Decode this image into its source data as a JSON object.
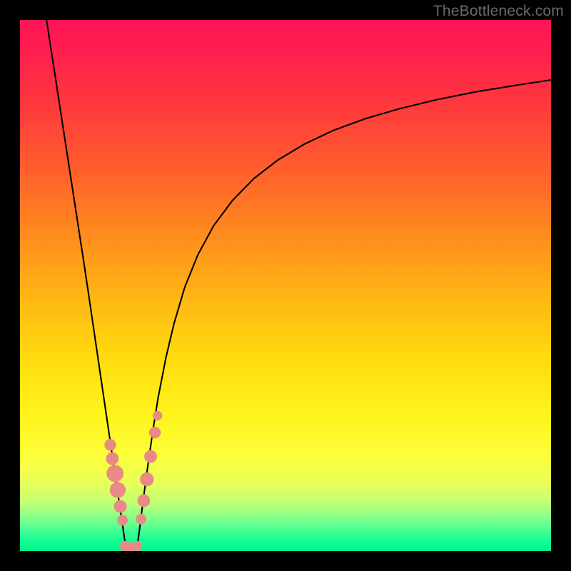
{
  "watermark": "TheBottleneck.com",
  "chart_data": {
    "type": "line",
    "title": "",
    "xlabel": "",
    "ylabel": "",
    "xlim": [
      0,
      100
    ],
    "ylim": [
      0,
      100
    ],
    "grid": false,
    "legend": false,
    "series": [
      {
        "name": "left-branch",
        "color": "#000000",
        "x": [
          5.0,
          6.0,
          7.0,
          8.0,
          9.0,
          10.0,
          11.0,
          12.0,
          13.0,
          14.0,
          15.0,
          16.0,
          17.0,
          18.0,
          18.5,
          19.0,
          19.5,
          20.0
        ],
        "y": [
          100.0,
          93.5,
          87.0,
          80.5,
          74.0,
          67.5,
          61.0,
          54.5,
          47.8,
          41.0,
          34.2,
          27.4,
          20.6,
          13.8,
          10.4,
          7.0,
          3.6,
          0.2
        ]
      },
      {
        "name": "right-branch",
        "color": "#000000",
        "x": [
          22.0,
          22.5,
          23.0,
          24.0,
          25.0,
          26.0,
          27.5,
          29.0,
          31.0,
          33.5,
          36.5,
          40.0,
          44.0,
          48.5,
          53.5,
          59.0,
          65.0,
          71.5,
          78.5,
          86.0,
          94.0,
          100.0
        ],
        "y": [
          0.2,
          4.0,
          8.0,
          15.5,
          22.5,
          28.8,
          36.5,
          42.8,
          49.6,
          55.8,
          61.3,
          66.0,
          70.1,
          73.6,
          76.6,
          79.2,
          81.4,
          83.3,
          85.0,
          86.5,
          87.8,
          88.7
        ]
      }
    ],
    "markers": [
      {
        "branch": "left",
        "x": 17.0,
        "y": 20.0,
        "r": 1.1
      },
      {
        "branch": "left",
        "x": 17.4,
        "y": 17.4,
        "r": 1.2
      },
      {
        "branch": "left",
        "x": 17.9,
        "y": 14.6,
        "r": 1.6
      },
      {
        "branch": "left",
        "x": 18.4,
        "y": 11.5,
        "r": 1.5
      },
      {
        "branch": "left",
        "x": 18.9,
        "y": 8.4,
        "r": 1.2
      },
      {
        "branch": "left",
        "x": 19.3,
        "y": 5.8,
        "r": 1.0
      },
      {
        "branch": "right",
        "x": 22.8,
        "y": 6.0,
        "r": 1.0
      },
      {
        "branch": "right",
        "x": 23.3,
        "y": 9.5,
        "r": 1.2
      },
      {
        "branch": "right",
        "x": 23.9,
        "y": 13.5,
        "r": 1.3
      },
      {
        "branch": "right",
        "x": 24.6,
        "y": 17.8,
        "r": 1.2
      },
      {
        "branch": "right",
        "x": 25.4,
        "y": 22.3,
        "r": 1.1
      },
      {
        "branch": "right",
        "x": 25.9,
        "y": 25.5,
        "r": 0.9
      },
      {
        "branch": "bottom",
        "x": 19.8,
        "y": 0.9,
        "r": 1.0
      },
      {
        "branch": "bottom",
        "x": 20.9,
        "y": 0.6,
        "r": 1.0
      },
      {
        "branch": "bottom",
        "x": 22.0,
        "y": 0.9,
        "r": 1.0
      }
    ],
    "marker_color": "#e98a86"
  }
}
